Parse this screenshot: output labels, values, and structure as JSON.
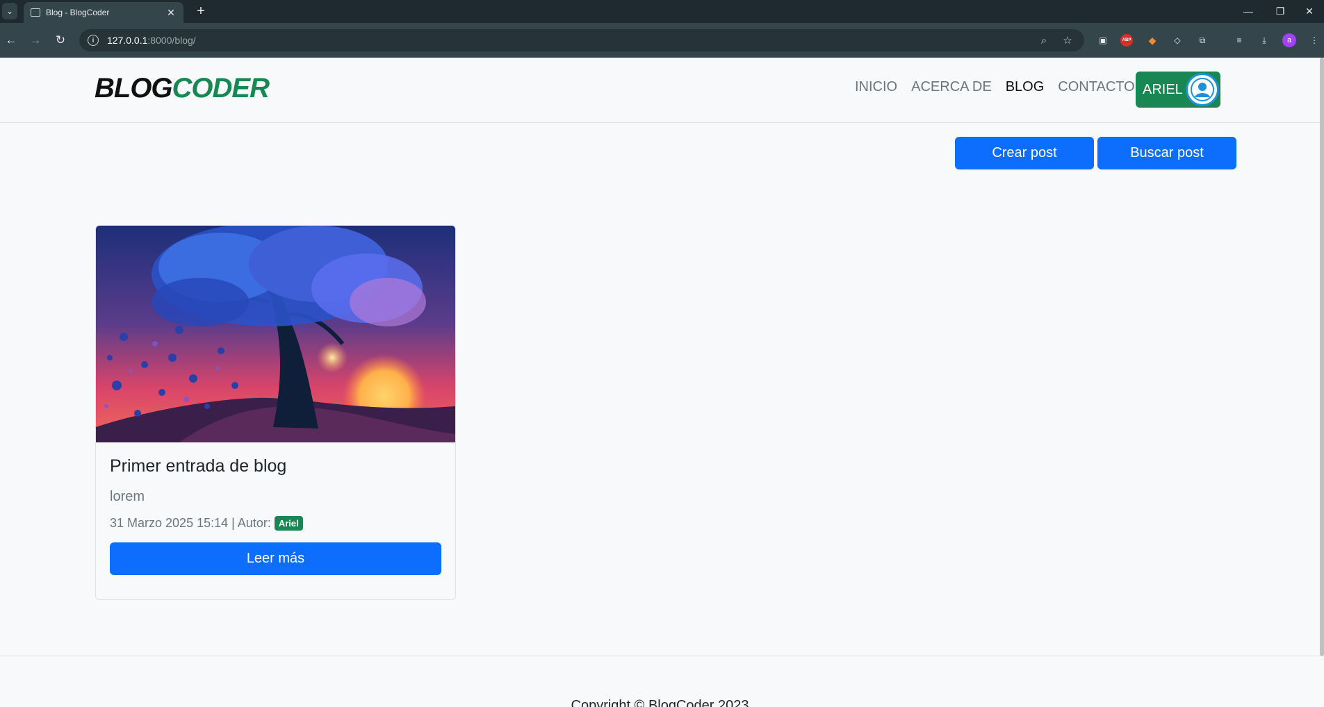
{
  "browser": {
    "tab_title": "Blog - BlogCoder",
    "tab_close": "✕",
    "new_tab": "+",
    "url_host": "127.0.0.1",
    "url_path": ":8000/blog/",
    "icons": [
      "back-icon",
      "forward-icon",
      "reload-icon",
      "info-icon",
      "zoom-icon",
      "star-icon",
      "extensions-icon",
      "download-icon",
      "menu-icon"
    ],
    "profile_initial": "a",
    "abp_label": "ABP"
  },
  "navbar": {
    "brand_part1": "BLOG",
    "brand_part2": "CODER",
    "links": [
      {
        "label": "INICIO"
      },
      {
        "label": "ACERCA DE"
      },
      {
        "label": "BLOG"
      },
      {
        "label": "CONTACTO"
      }
    ],
    "active": "BLOG",
    "user_label": "ARIEL"
  },
  "actions": {
    "create_label": "Crear post",
    "search_label": "Buscar post"
  },
  "posts": [
    {
      "title": "Primer entrada de blog",
      "summary": "lorem",
      "meta": "31 Marzo 2025 15:14 | Autor:",
      "author": "Ariel",
      "read_more": "Leer más"
    }
  ],
  "footer": {
    "text": "Copyright © BlogCoder 2023"
  },
  "colors": {
    "primary": "#0d6efd",
    "success": "#198754",
    "brand_dark": "#111111"
  }
}
